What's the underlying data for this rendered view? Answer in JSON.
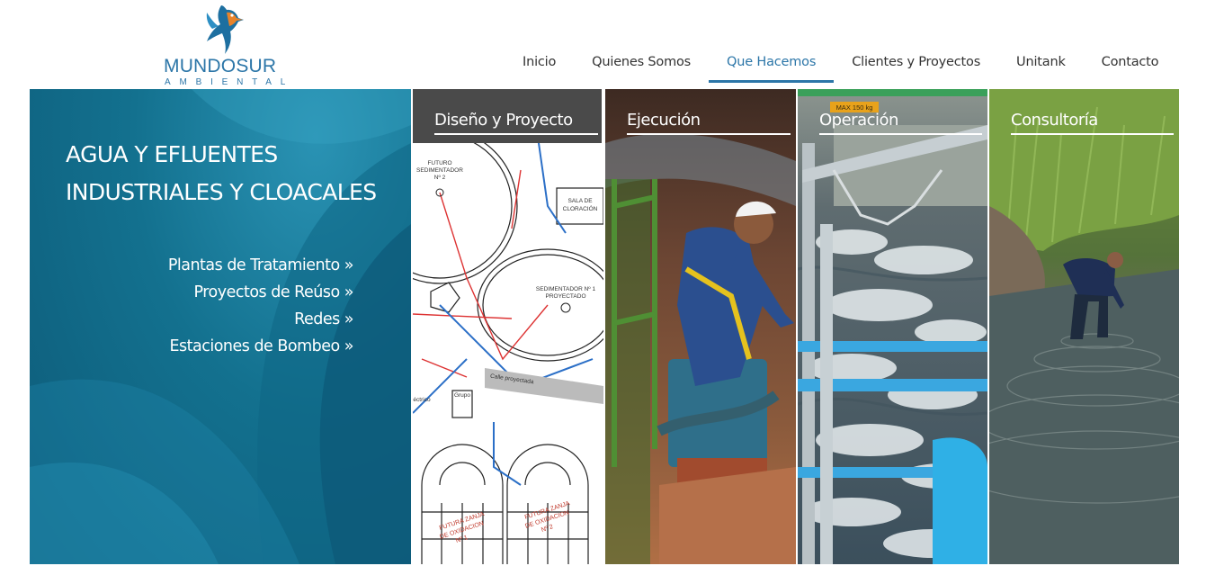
{
  "brand": {
    "name": "MUNDOSUR",
    "tagline": "AMBIENTAL",
    "logo_icon": "kingfisher-bird-icon",
    "color": "#2c76a8"
  },
  "nav": {
    "items": [
      {
        "label": "Inicio"
      },
      {
        "label": "Quienes Somos"
      },
      {
        "label": "Que Hacemos",
        "active": true
      },
      {
        "label": "Clientes y Proyectos"
      },
      {
        "label": "Unitank"
      },
      {
        "label": "Contacto"
      }
    ]
  },
  "hero": {
    "title_line1": "AGUA Y EFLUENTES",
    "title_line2": "INDUSTRIALES Y CLOACALES",
    "links": [
      "Plantas de Tratamiento »",
      "Proyectos de Reúso »",
      "Redes »",
      "Estaciones de Bombeo »"
    ],
    "panel_color": "#13718f"
  },
  "panels": [
    {
      "title": "Diseño y Proyecto",
      "plan_labels": {
        "futuro_sed_1": "FUTURO",
        "futuro_sed_2": "SEDIMENTADOR",
        "futuro_sed_3": "Nº 2",
        "sala_1": "SALA DE",
        "sala_2": "CLORACIÓN",
        "sed_1": "SEDIMENTADOR Nº 1",
        "sed_2": "PROYECTADO",
        "calle": "Calle proyectada",
        "grupo": "Grupo",
        "electrico": "éctrico",
        "zanja1_1": "FUTURA ZANJA",
        "zanja1_2": "DE OXIDACION",
        "zanja1_3": "Nº 1",
        "zanja2_1": "FUTURA ZANJA",
        "zanja2_2": "DE OXIDACION",
        "zanja2_3": "Nº 2"
      }
    },
    {
      "title": "Ejecución"
    },
    {
      "title": "Operación",
      "sign": "MAX 150 kg"
    },
    {
      "title": "Consultoría"
    }
  ]
}
